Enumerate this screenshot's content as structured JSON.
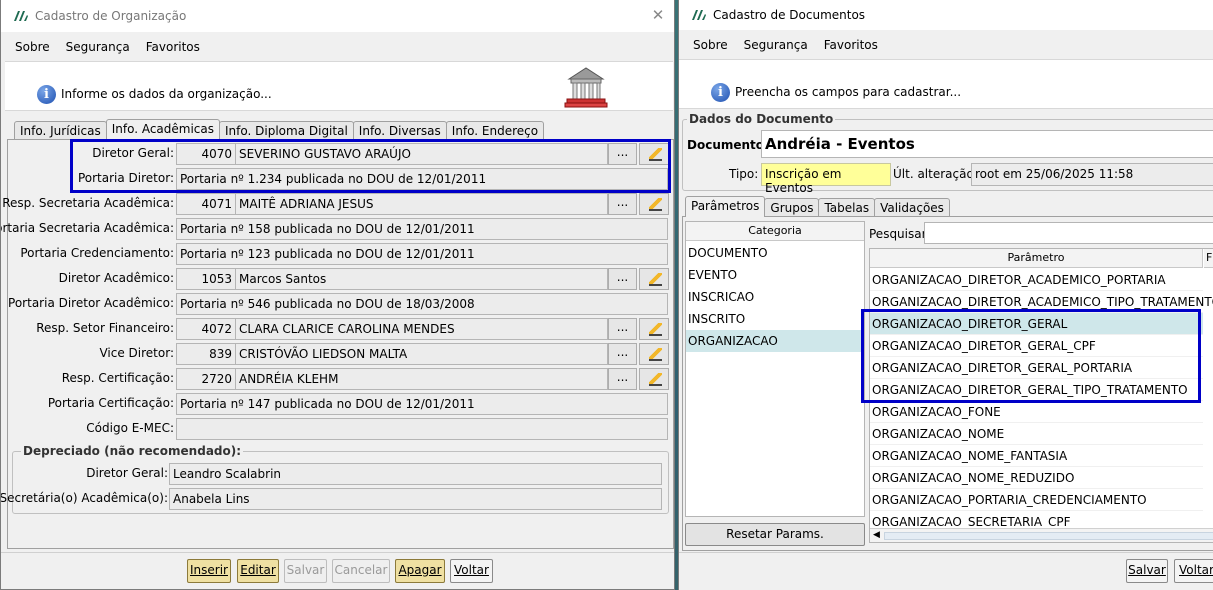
{
  "win1": {
    "title": "Cadastro de Organização",
    "menu": [
      "Sobre",
      "Segurança",
      "Favoritos"
    ],
    "info": "Informe os dados da organização...",
    "tabs": [
      "Info. Jurídicas",
      "Info. Acadêmicas",
      "Info. Diploma Digital",
      "Info. Diversas",
      "Info. Endereço"
    ],
    "fields": {
      "diretor_geral": {
        "label": "Diretor Geral:",
        "code": "4070",
        "name": "SEVERINO GUSTAVO ARAÚJO"
      },
      "portaria_diretor": {
        "label": "Portaria Diretor:",
        "value": "Portaria nº 1.234 publicada no DOU de 12/01/2011"
      },
      "resp_secretaria": {
        "label": "Resp. Secretaria Acadêmica:",
        "code": "4071",
        "name": "MAITÊ ADRIANA JESUS"
      },
      "portaria_secretaria": {
        "label": "Portaria Secretaria Acadêmica:",
        "value": "Portaria nº 158 publicada no DOU de 12/01/2011"
      },
      "portaria_credenciamento": {
        "label": "Portaria Credenciamento:",
        "value": "Portaria nº 123 publicada no DOU de 12/01/2011"
      },
      "diretor_academico": {
        "label": "Diretor Acadêmico:",
        "code": "1053",
        "name": "Marcos Santos"
      },
      "portaria_diretor_academico": {
        "label": "Portaria Diretor Acadêmico:",
        "value": "Portaria nº 546 publicada no DOU de 18/03/2008"
      },
      "resp_financeiro": {
        "label": "Resp. Setor Financeiro:",
        "code": "4072",
        "name": "CLARA CLARICE CAROLINA MENDES"
      },
      "vice_diretor": {
        "label": "Vice Diretor:",
        "code": "839",
        "name": "CRISTÓVÃO LIEDSON MALTA"
      },
      "resp_certificacao": {
        "label": "Resp. Certificação:",
        "code": "2720",
        "name": "ANDRÉIA KLEHM"
      },
      "portaria_certificacao": {
        "label": "Portaria Certificação:",
        "value": "Portaria nº 147 publicada no DOU de 12/01/2011"
      },
      "codigo_emec": {
        "label": "Código E-MEC:",
        "value": ""
      }
    },
    "depreciado": {
      "title": "Depreciado (não recomendado):",
      "diretor_geral": {
        "label": "Diretor Geral:",
        "value": "Leandro Scalabrin"
      },
      "secretaria": {
        "label": "Secretária(o) Acadêmica(o):",
        "value": "Anabela Lins"
      }
    },
    "dots_label": "...",
    "buttons": {
      "inserir": "Inserir",
      "editar": "Editar",
      "salvar": "Salvar",
      "cancelar": "Cancelar",
      "apagar": "Apagar",
      "voltar": "Voltar"
    }
  },
  "win2": {
    "title": "Cadastro de Documentos",
    "menu": [
      "Sobre",
      "Segurança",
      "Favoritos"
    ],
    "info": "Preencha os campos para cadastrar...",
    "section_title": "Dados do Documento",
    "documento_label": "Documento:",
    "documento_value": "Andréia - Eventos",
    "tipo_label": "Tipo:",
    "tipo_value": "Inscrição em Eventos",
    "alteracao_label": "Últ. alteração:",
    "alteracao_value": "root em 25/06/2025 11:58",
    "tabs": [
      "Parâmetros",
      "Grupos",
      "Tabelas",
      "Validações"
    ],
    "categoria_header": "Categoria",
    "categorias": [
      "DOCUMENTO",
      "EVENTO",
      "INSCRICAO",
      "INSCRITO",
      "ORGANIZACAO"
    ],
    "pesquisar_label": "Pesquisar:",
    "parametro_header": "Parâmetro",
    "parametro_header2": "F",
    "parametros": [
      "ORGANIZACAO_DIRETOR_ACADEMICO_PORTARIA",
      "ORGANIZACAO_DIRETOR_ACADEMICO_TIPO_TRATAMENTO",
      "ORGANIZACAO_DIRETOR_GERAL",
      "ORGANIZACAO_DIRETOR_GERAL_CPF",
      "ORGANIZACAO_DIRETOR_GERAL_PORTARIA",
      "ORGANIZACAO_DIRETOR_GERAL_TIPO_TRATAMENTO",
      "ORGANIZACAO_FONE",
      "ORGANIZACAO_NOME",
      "ORGANIZACAO_NOME_FANTASIA",
      "ORGANIZACAO_NOME_REDUZIDO",
      "ORGANIZACAO_PORTARIA_CREDENCIAMENTO",
      "ORGANIZACAO_SECRETARIA_CPF"
    ],
    "resetar_label": "Resetar Params.",
    "buttons": {
      "salvar": "Salvar",
      "voltar": "Voltar"
    }
  },
  "colors": {
    "highlight": "#0000c8",
    "selection": "#cfe7ea",
    "tipo_bg": "#ffff99",
    "gold_button": "#efe0a2"
  }
}
